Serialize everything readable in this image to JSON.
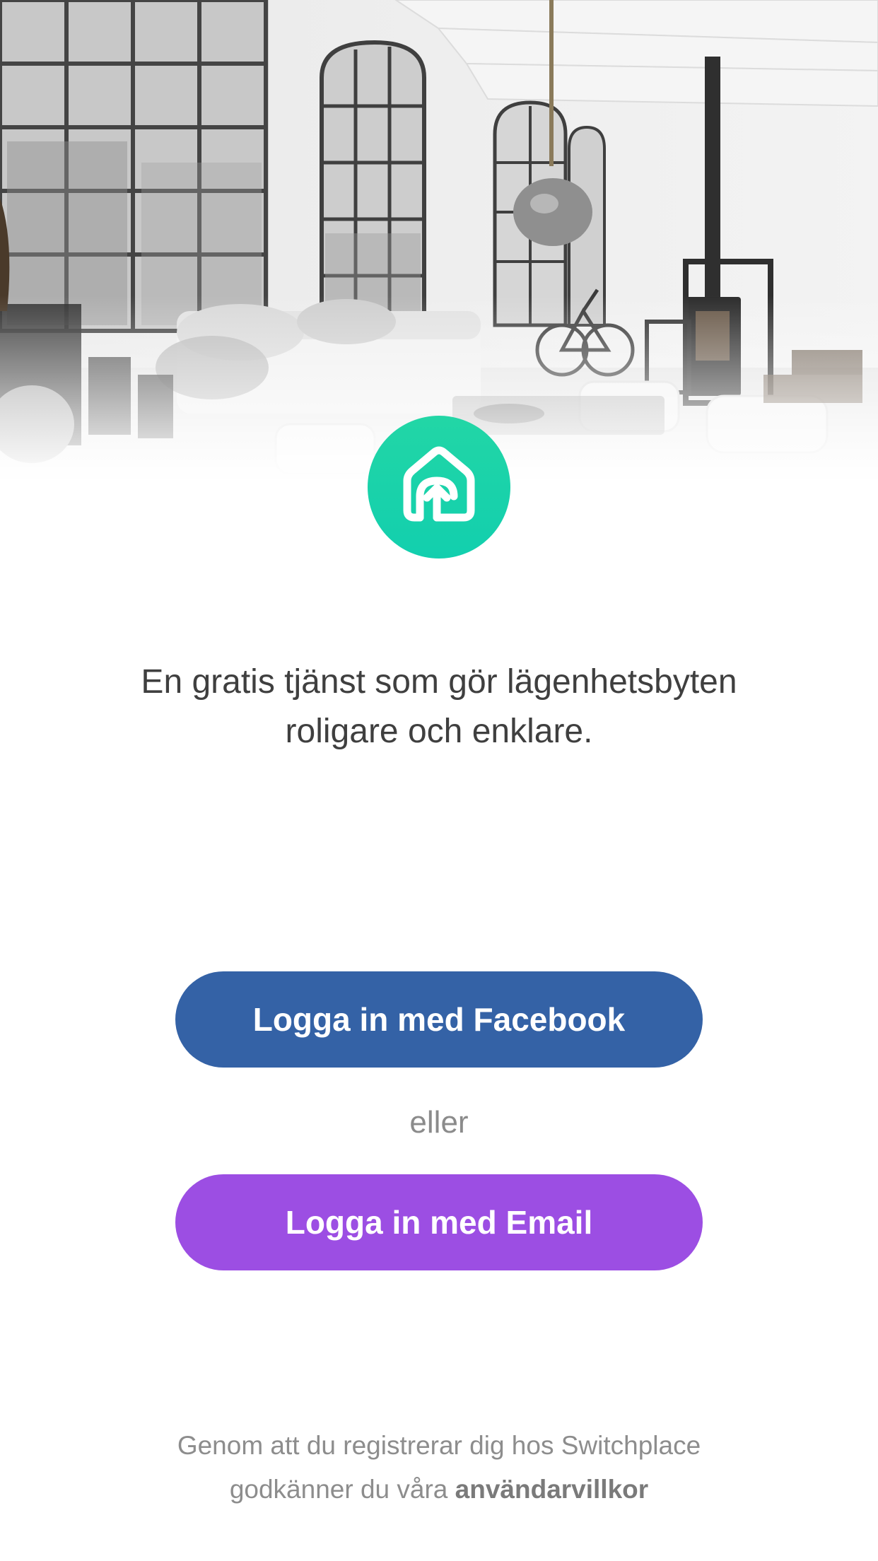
{
  "hero": {
    "image": "interior-loft-photo"
  },
  "logo": {
    "icon": "house-upload-icon",
    "color": "#1ed3ab"
  },
  "tagline": {
    "line1": "En gratis tjänst som gör lägenhetsbyten",
    "line2": "roligare och enklare."
  },
  "buttons": {
    "facebook_label": "Logga in med Facebook",
    "facebook_color": "#3462a6",
    "or_text": "eller",
    "email_label": "Logga in med Email",
    "email_color": "#9c4ee3"
  },
  "footer": {
    "line1": "Genom att du registrerar dig hos Switchplace",
    "line2_prefix": "godkänner du våra",
    "terms_link": "användarvillkor"
  }
}
